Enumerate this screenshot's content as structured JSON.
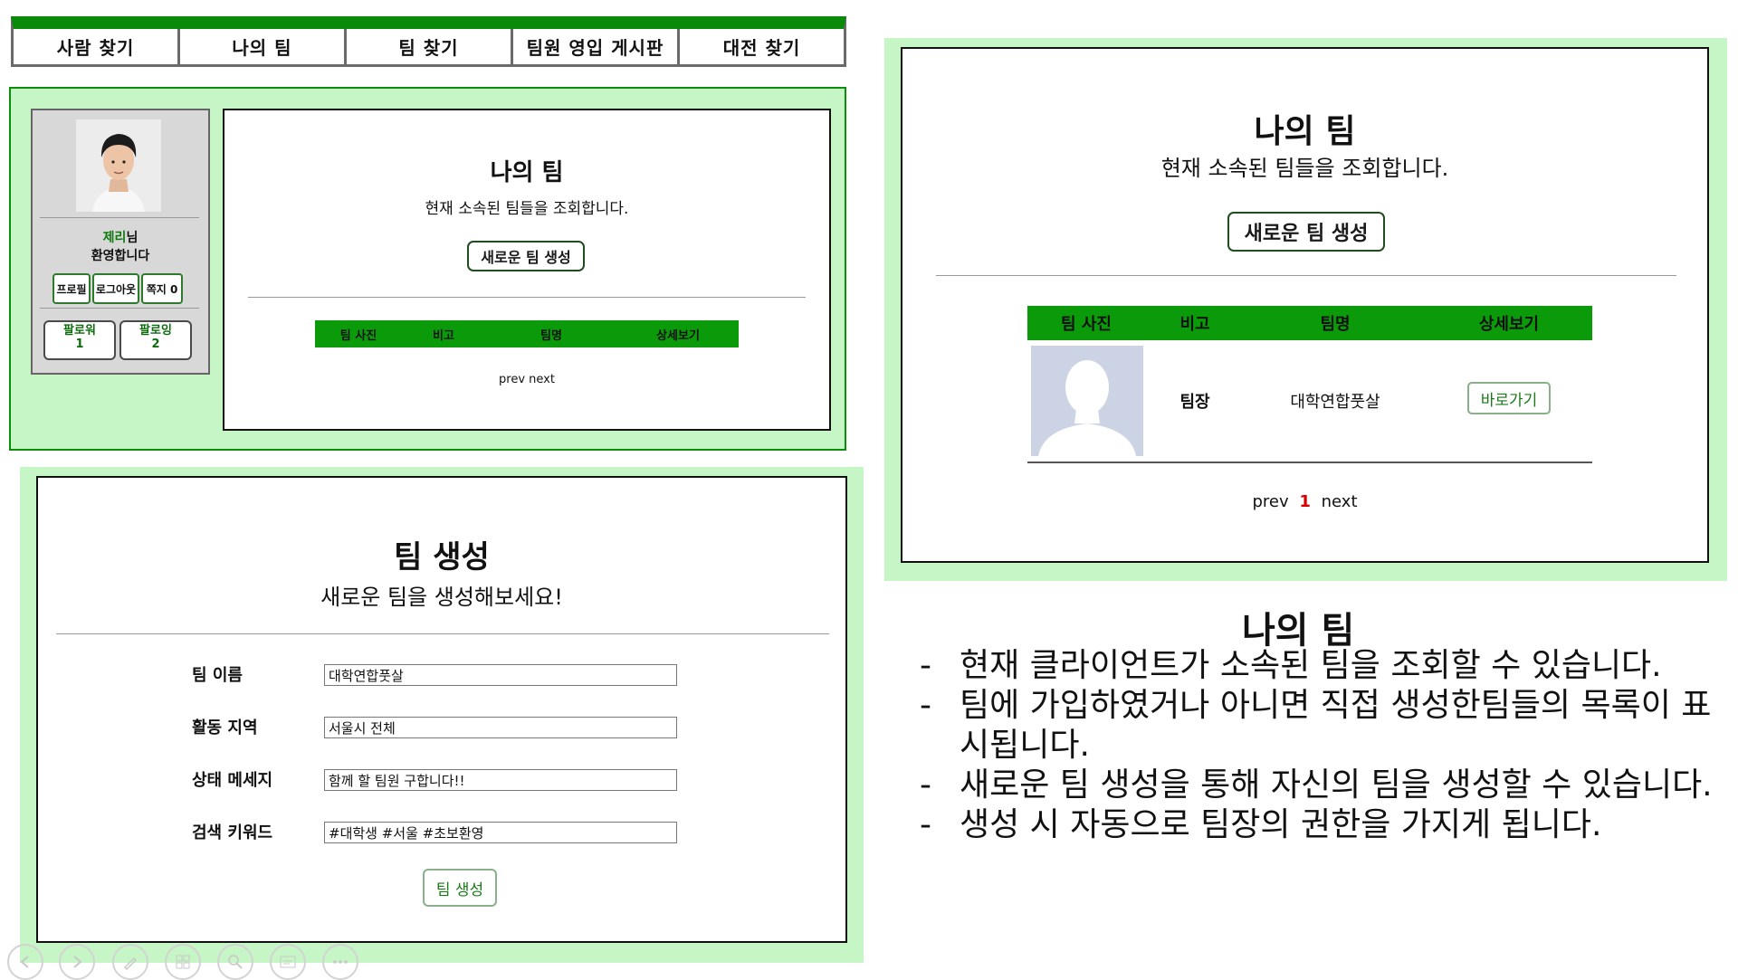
{
  "nav": {
    "items": [
      "사람 찾기",
      "나의 팀",
      "팀 찾기",
      "팀원 영입 게시판",
      "대전 찾기"
    ]
  },
  "profile": {
    "name": "제리",
    "name_suffix": "님",
    "welcome": "환영합니다",
    "buttons": [
      "프로필",
      "로그아웃",
      "쪽지 0"
    ],
    "follower_label": "팔로워",
    "follower_count": "1",
    "following_label": "팔로잉",
    "following_count": "2"
  },
  "myteam": {
    "title": "나의 팀",
    "subtitle": "현재 소속된 팀들을 조회합니다.",
    "create_button": "새로운 팀 생성",
    "columns": [
      "팀 사진",
      "비고",
      "팀명",
      "상세보기"
    ],
    "pager_prev": "prev",
    "pager_next": "next",
    "pager_current": "1",
    "rows": [
      {
        "role": "팀장",
        "team_name": "대학연합풋살",
        "detail_button": "바로가기"
      }
    ]
  },
  "create": {
    "title": "팀 생성",
    "subtitle": "새로운 팀을 생성해보세요!",
    "fields": [
      {
        "label": "팀 이름",
        "value": "대학연합풋살"
      },
      {
        "label": "활동 지역",
        "value": "서울시 전체"
      },
      {
        "label": "상태 메세지",
        "value": "함께 할 팀원 구합니다!!"
      },
      {
        "label": "검색 키워드",
        "value": "#대학생 #서울 #초보환영"
      }
    ],
    "submit": "팀 생성"
  },
  "description": {
    "title": "나의 팀",
    "items": [
      "현재 클라이언트가 소속된 팀을 조회할 수 있습니다.",
      "팀에 가입하였거나 아니면 직접 생성한팀들의 목록이 표시됩니다.",
      "새로운 팀 생성을 통해 자신의 팀을 생성할 수 있습니다.",
      "생성 시 자동으로 팀장의 권한을 가지게 됩니다."
    ]
  },
  "colors": {
    "accent_green": "#0a9a0a",
    "panel_bg": "#c6f5c6",
    "pager_current": "#d40000"
  },
  "presenter_controls": [
    "previous-icon",
    "next-icon",
    "pen-icon",
    "slides-icon",
    "zoom-icon",
    "subtitle-icon",
    "more-icon"
  ]
}
